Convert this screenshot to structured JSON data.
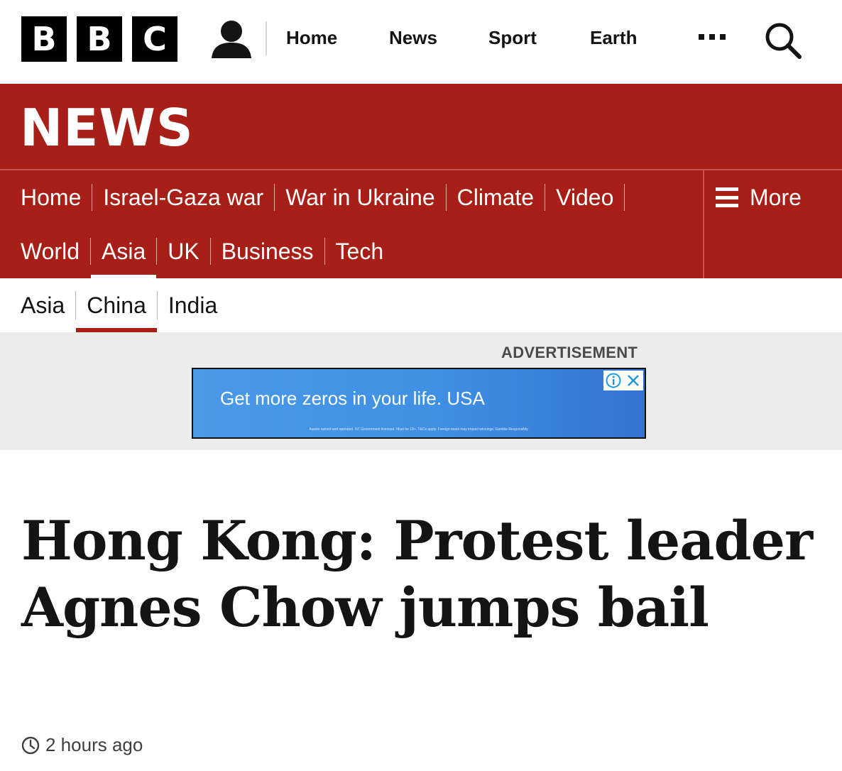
{
  "brand": {
    "logo_letters": [
      "B",
      "B",
      "C"
    ],
    "section_title": "NEWS",
    "accent_color": "#a81f17"
  },
  "top_nav": {
    "account_icon": "person-icon",
    "home": "Home",
    "news": "News",
    "sport": "Sport",
    "earth": "Earth",
    "more_icon": "ellipsis-icon",
    "search_icon": "search-icon"
  },
  "news_nav": {
    "row1": [
      "Home",
      "Israel-Gaza war",
      "War in Ukraine",
      "Climate",
      "Video"
    ],
    "row2": [
      "World",
      "Asia",
      "UK",
      "Business",
      "Tech"
    ],
    "active": "Asia",
    "more_label": "More",
    "more_icon": "hamburger-icon"
  },
  "sub_nav": {
    "items": [
      "Asia",
      "China",
      "India"
    ],
    "active": "China"
  },
  "advert": {
    "label": "ADVERTISEMENT",
    "headline": "Get more zeros in your life. USA",
    "fine_print": "Aussie owned and operated. NT Government licensed. Must be 18+. T&Cs apply. Foreign taxes may impact winnings. Gamble Responsibly.",
    "info_icon": "info-icon",
    "close_icon": "close-icon"
  },
  "article": {
    "headline": "Hong Kong: Protest leader Agnes Chow jumps bail",
    "timestamp": "2 hours ago",
    "clock_icon": "clock-icon"
  }
}
